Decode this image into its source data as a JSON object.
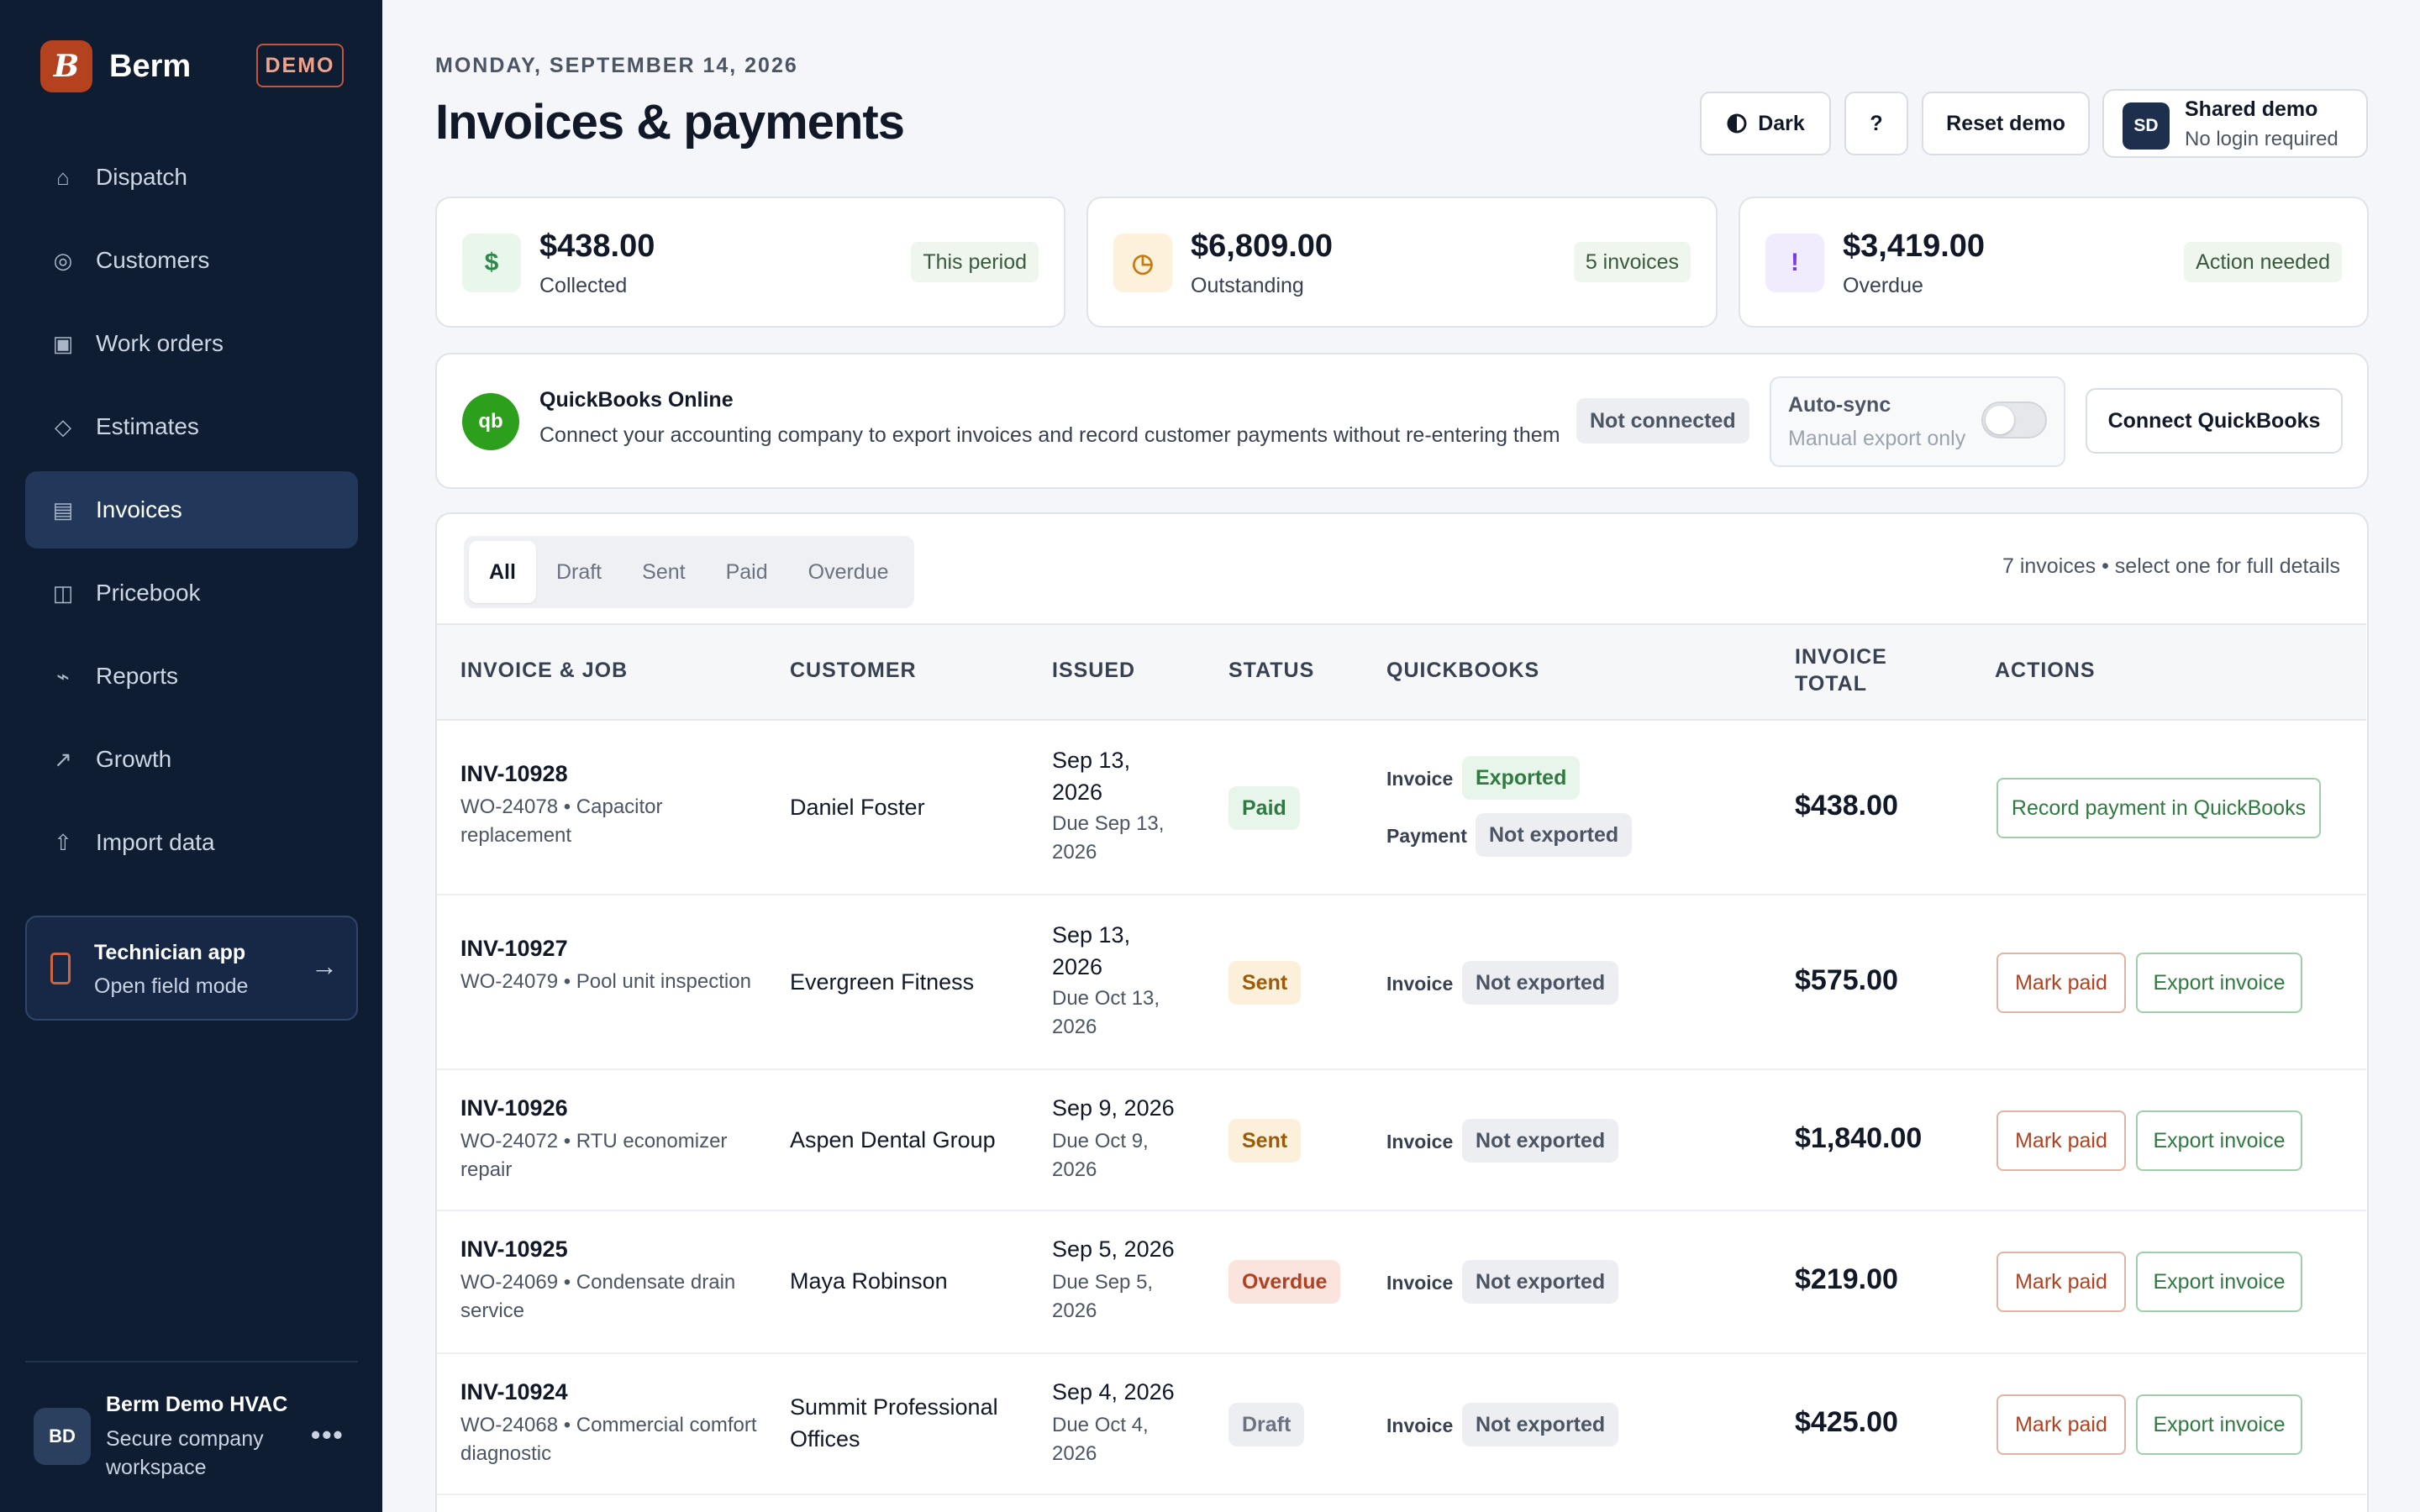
{
  "sidebar": {
    "brand": {
      "logo_letter": "B",
      "name": "Berm",
      "badge": "DEMO"
    },
    "nav": [
      {
        "label": "Dispatch",
        "icon": "home-icon",
        "glyph": "⌂"
      },
      {
        "label": "Customers",
        "icon": "customers-icon",
        "glyph": "◎"
      },
      {
        "label": "Work orders",
        "icon": "work-orders-icon",
        "glyph": "▣"
      },
      {
        "label": "Estimates",
        "icon": "diamond-icon",
        "glyph": "◇"
      },
      {
        "label": "Invoices",
        "icon": "invoice-icon",
        "glyph": "▤",
        "active": true
      },
      {
        "label": "Pricebook",
        "icon": "book-icon",
        "glyph": "◫"
      },
      {
        "label": "Reports",
        "icon": "reports-icon",
        "glyph": "⌁"
      },
      {
        "label": "Growth",
        "icon": "growth-arrow-icon",
        "glyph": "↗"
      },
      {
        "label": "Import data",
        "icon": "upload-icon",
        "glyph": "⇧"
      }
    ],
    "tech_app": {
      "title": "Technician app",
      "subtitle": "Open field mode",
      "arrow": "→"
    },
    "workspace": {
      "initials": "BD",
      "name": "Berm Demo HVAC",
      "subtitle": "Secure company workspace",
      "more": "•••"
    }
  },
  "header": {
    "date": "MONDAY, SEPTEMBER 14, 2026",
    "title": "Invoices & payments",
    "dark_label": "Dark",
    "help_label": "?",
    "reset_label": "Reset demo",
    "user": {
      "initials": "SD",
      "name": "Shared demo",
      "subtitle": "No login required"
    }
  },
  "stats": [
    {
      "value": "$438.00",
      "label": "Collected",
      "pill": "This period",
      "icon": "dollar-icon",
      "glyph": "$",
      "color": "#2f8a4a",
      "bg": "#e8f6ec"
    },
    {
      "value": "$6,809.00",
      "label": "Outstanding",
      "pill": "5 invoices",
      "icon": "clock-icon",
      "glyph": "◷",
      "color": "#c77a12",
      "bg": "#fdf1dc"
    },
    {
      "value": "$3,419.00",
      "label": "Overdue",
      "pill": "Action needed",
      "icon": "alert-icon",
      "glyph": "!",
      "color": "#7c3aed",
      "bg": "#f1ecfd"
    }
  ],
  "quickbooks": {
    "logo": "qb",
    "title": "QuickBooks Online",
    "description": "Connect your accounting company to export invoices and record customer payments without re-entering them",
    "status": "Not connected",
    "autosync_title": "Auto-sync",
    "autosync_sub": "Manual export only",
    "autosync_on": false,
    "connect_label": "Connect QuickBooks"
  },
  "table": {
    "tabs": [
      "All",
      "Draft",
      "Sent",
      "Paid",
      "Overdue"
    ],
    "active_tab": "All",
    "count_text": "7 invoices • select one for full details",
    "headers": {
      "invoice": "INVOICE & JOB",
      "customer": "CUSTOMER",
      "issued": "ISSUED",
      "status": "STATUS",
      "quickbooks": "QUICKBOOKS",
      "total": "INVOICE TOTAL",
      "actions": "ACTIONS"
    },
    "rows": [
      {
        "number": "INV-10928",
        "job": "WO-24078 • Capacitor replacement",
        "customer": "Daniel Foster",
        "issued": "Sep 13, 2026",
        "due": "Due Sep 13, 2026",
        "status": "Paid",
        "invoice_label": "Invoice",
        "invoice_qb": "Exported",
        "payment_label": "Payment",
        "payment_qb": "Not exported",
        "total": "$438.00",
        "action_record": "Record payment in QuickBooks"
      },
      {
        "number": "INV-10927",
        "job": "WO-24079 • Pool unit inspection",
        "customer": "Evergreen Fitness",
        "issued": "Sep 13, 2026",
        "due": "Due Oct 13, 2026",
        "status": "Sent",
        "invoice_label": "Invoice",
        "invoice_qb": "Not exported",
        "total": "$575.00",
        "action_mark": "Mark paid",
        "action_export": "Export invoice"
      },
      {
        "number": "INV-10926",
        "job": "WO-24072 • RTU economizer repair",
        "customer": "Aspen Dental Group",
        "issued": "Sep 9, 2026",
        "due": "Due Oct 9, 2026",
        "status": "Sent",
        "invoice_label": "Invoice",
        "invoice_qb": "Not exported",
        "total": "$1,840.00",
        "action_mark": "Mark paid",
        "action_export": "Export invoice"
      },
      {
        "number": "INV-10925",
        "job": "WO-24069 • Condensate drain service",
        "customer": "Maya Robinson",
        "issued": "Sep 5, 2026",
        "due": "Due Sep 5, 2026",
        "status": "Overdue",
        "invoice_label": "Invoice",
        "invoice_qb": "Not exported",
        "total": "$219.00",
        "action_mark": "Mark paid",
        "action_export": "Export invoice"
      },
      {
        "number": "INV-10924",
        "job": "WO-24068 • Commercial comfort diagnostic",
        "customer": "Summit Professional Offices",
        "issued": "Sep 4, 2026",
        "due": "Due Oct 4, 2026",
        "status": "Draft",
        "invoice_label": "Invoice",
        "invoice_qb": "Not exported",
        "total": "$425.00",
        "action_mark": "Mark paid",
        "action_export": "Export invoice"
      }
    ]
  }
}
